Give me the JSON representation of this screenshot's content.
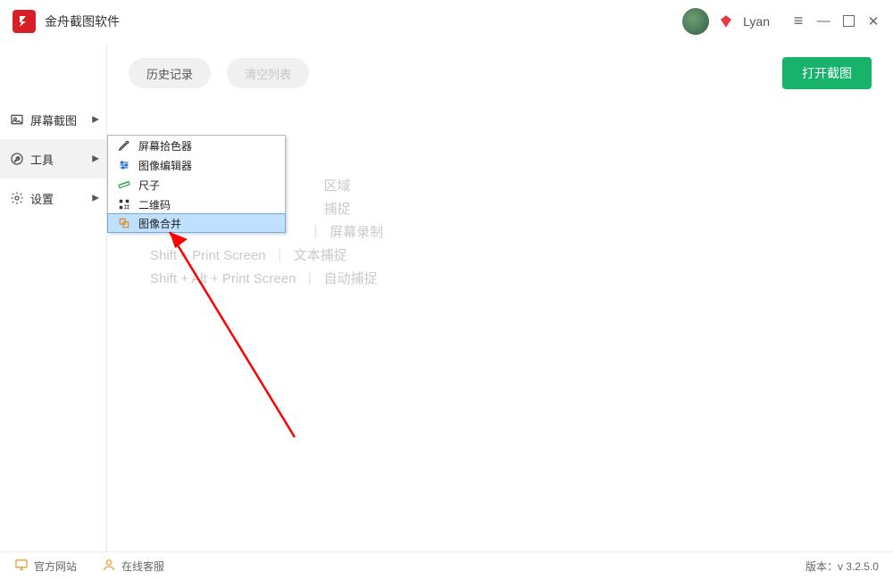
{
  "app": {
    "title": "金舟截图软件",
    "username": "Lyan"
  },
  "sidebar": {
    "items": [
      {
        "label": "屏幕截图"
      },
      {
        "label": "工具"
      },
      {
        "label": "设置"
      }
    ]
  },
  "toolbar": {
    "history_label": "历史记录",
    "clear_label": "清空列表",
    "primary_label": "打开截图"
  },
  "hints": {
    "r0_l": "",
    "r0_r": "区域",
    "r1_l": "",
    "r1_r": "捕捉",
    "r2_l": "",
    "r2_r": "屏幕录制",
    "r3_l": "Shift + Print Screen",
    "r3_r": "文本捕捉",
    "r4_l": "Shift + Alt + Print Screen",
    "r4_r": "自动捕捉"
  },
  "submenu": {
    "items": [
      {
        "label": "屏幕拾色器"
      },
      {
        "label": "图像编辑器"
      },
      {
        "label": "尺子"
      },
      {
        "label": "二维码"
      },
      {
        "label": "图像合并"
      }
    ]
  },
  "footer": {
    "site_label": "官方网站",
    "support_label": "在线客服",
    "version_label": "版本：v 3.2.5.0"
  }
}
